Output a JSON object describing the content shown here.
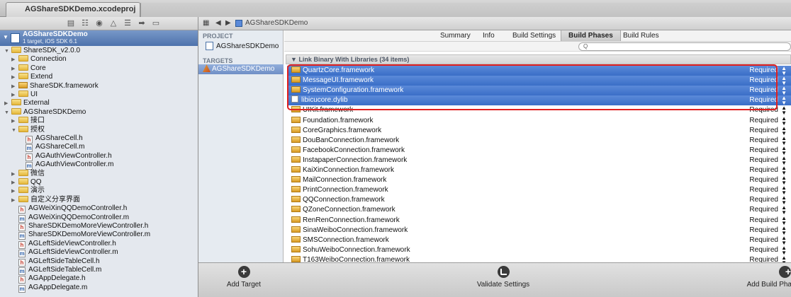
{
  "window": {
    "tab_title": "AGShareSDKDemo.xcodeproj"
  },
  "jumpbar": {
    "project": "AGShareSDKDemo"
  },
  "navigator": {
    "project_name": "AGShareSDKDemo",
    "project_sub": "1 target, iOS SDK 6.1",
    "items": [
      {
        "label": "ShareSDK_v2.0.0",
        "kind": "folder",
        "indent": 1,
        "open": true
      },
      {
        "label": "Connection",
        "kind": "folder",
        "indent": 2,
        "open": false
      },
      {
        "label": "Core",
        "kind": "folder",
        "indent": 2,
        "open": false
      },
      {
        "label": "Extend",
        "kind": "folder",
        "indent": 2,
        "open": false
      },
      {
        "label": "ShareSDK.framework",
        "kind": "framework",
        "indent": 2,
        "open": false
      },
      {
        "label": "UI",
        "kind": "folder",
        "indent": 2,
        "open": false
      },
      {
        "label": "External",
        "kind": "folder",
        "indent": 1,
        "open": false
      },
      {
        "label": "AGShareSDKDemo",
        "kind": "folder",
        "indent": 1,
        "open": true
      },
      {
        "label": "接口",
        "kind": "folder",
        "indent": 2,
        "open": false
      },
      {
        "label": "授权",
        "kind": "folder",
        "indent": 2,
        "open": true
      },
      {
        "label": "AGShareCell.h",
        "kind": "h",
        "indent": 3
      },
      {
        "label": "AGShareCell.m",
        "kind": "m",
        "indent": 3
      },
      {
        "label": "AGAuthViewController.h",
        "kind": "h",
        "indent": 3
      },
      {
        "label": "AGAuthViewController.m",
        "kind": "m",
        "indent": 3
      },
      {
        "label": "微信",
        "kind": "folder",
        "indent": 2,
        "open": false
      },
      {
        "label": "QQ",
        "kind": "folder",
        "indent": 2,
        "open": false
      },
      {
        "label": "演示",
        "kind": "folder",
        "indent": 2,
        "open": false
      },
      {
        "label": "自定义分享界面",
        "kind": "folder",
        "indent": 2,
        "open": false
      },
      {
        "label": "AGWeiXinQQDemoController.h",
        "kind": "h",
        "indent": 2
      },
      {
        "label": "AGWeiXinQQDemoController.m",
        "kind": "m",
        "indent": 2
      },
      {
        "label": "ShareSDKDemoMoreViewController.h",
        "kind": "h",
        "indent": 2
      },
      {
        "label": "ShareSDKDemoMoreViewController.m",
        "kind": "m",
        "indent": 2
      },
      {
        "label": "AGLeftSideViewController.h",
        "kind": "h",
        "indent": 2
      },
      {
        "label": "AGLeftSideViewController.m",
        "kind": "m",
        "indent": 2
      },
      {
        "label": "AGLeftSideTableCell.h",
        "kind": "h",
        "indent": 2
      },
      {
        "label": "AGLeftSideTableCell.m",
        "kind": "m",
        "indent": 2
      },
      {
        "label": "AGAppDelegate.h",
        "kind": "h",
        "indent": 2
      },
      {
        "label": "AGAppDelegate.m",
        "kind": "m",
        "indent": 2
      }
    ]
  },
  "targets_panel": {
    "project_label": "PROJECT",
    "project_item": "AGShareSDKDemo",
    "targets_label": "TARGETS",
    "target_item": "AGShareSDKDemo"
  },
  "editor": {
    "tabs": [
      "Summary",
      "Info",
      "Build Settings",
      "Build Phases",
      "Build Rules"
    ],
    "active_tab": "Build Phases",
    "search_icon": "Q",
    "phase_title": "Link Binary With Libraries (34 items)",
    "libraries": [
      {
        "name": "QuartzCore.framework",
        "status": "Required",
        "selected": true,
        "kind": "framework"
      },
      {
        "name": "MessageUI.framework",
        "status": "Required",
        "selected": true,
        "kind": "framework"
      },
      {
        "name": "SystemConfiguration.framework",
        "status": "Required",
        "selected": true,
        "kind": "framework"
      },
      {
        "name": "libicucore.dylib",
        "status": "Required",
        "selected": true,
        "kind": "dylib"
      },
      {
        "name": "UIKit.framework",
        "status": "Required",
        "selected": false,
        "kind": "framework"
      },
      {
        "name": "Foundation.framework",
        "status": "Required",
        "selected": false,
        "kind": "framework"
      },
      {
        "name": "CoreGraphics.framework",
        "status": "Required",
        "selected": false,
        "kind": "framework"
      },
      {
        "name": "DouBanConnection.framework",
        "status": "Required",
        "selected": false,
        "kind": "framework"
      },
      {
        "name": "FacebookConnection.framework",
        "status": "Required",
        "selected": false,
        "kind": "framework"
      },
      {
        "name": "InstapaperConnection.framework",
        "status": "Required",
        "selected": false,
        "kind": "framework"
      },
      {
        "name": "KaiXinConnection.framework",
        "status": "Required",
        "selected": false,
        "kind": "framework"
      },
      {
        "name": "MailConnection.framework",
        "status": "Required",
        "selected": false,
        "kind": "framework"
      },
      {
        "name": "PrintConnection.framework",
        "status": "Required",
        "selected": false,
        "kind": "framework"
      },
      {
        "name": "QQConnection.framework",
        "status": "Required",
        "selected": false,
        "kind": "framework"
      },
      {
        "name": "QZoneConnection.framework",
        "status": "Required",
        "selected": false,
        "kind": "framework"
      },
      {
        "name": "RenRenConnection.framework",
        "status": "Required",
        "selected": false,
        "kind": "framework"
      },
      {
        "name": "SinaWeiboConnection.framework",
        "status": "Required",
        "selected": false,
        "kind": "framework"
      },
      {
        "name": "SMSConnection.framework",
        "status": "Required",
        "selected": false,
        "kind": "framework"
      },
      {
        "name": "SohuWeiboConnection.framework",
        "status": "Required",
        "selected": false,
        "kind": "framework"
      },
      {
        "name": "T163WeiboConnection.framework",
        "status": "Required",
        "selected": false,
        "kind": "framework"
      }
    ]
  },
  "bottom": {
    "add_target": "Add Target",
    "validate": "Validate Settings",
    "add_phase": "Add Build Phas"
  },
  "colors": {
    "selection": "#3a6ec7",
    "highlight": "#e02020"
  }
}
